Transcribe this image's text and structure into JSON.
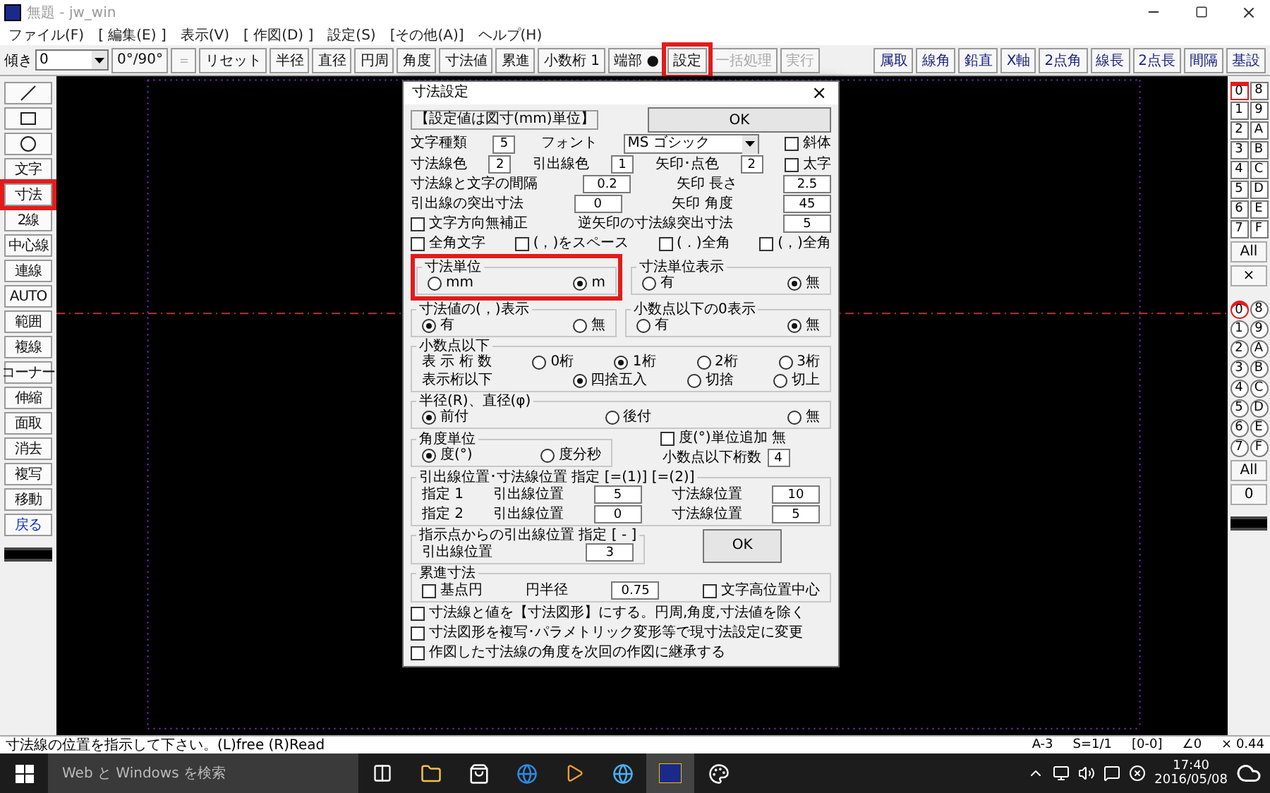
{
  "window": {
    "title": "無題 - jw_win"
  },
  "menu": [
    "ファイル(F)",
    "[ 編集(E) ]",
    "表示(V)",
    "[ 作図(D) ]",
    "設定(S)",
    "[その他(A)]",
    "ヘルプ(H)"
  ],
  "toolbar": {
    "tilt_label": "傾き",
    "tilt_value": "0",
    "buttons": [
      {
        "label": "0°/90°",
        "disabled": false,
        "highlighted": false
      },
      {
        "label": "＝",
        "disabled": true,
        "highlighted": false
      },
      {
        "label": "リセット",
        "disabled": false,
        "highlighted": false
      },
      {
        "label": "半径",
        "disabled": false,
        "highlighted": false
      },
      {
        "label": "直径",
        "disabled": false,
        "highlighted": false
      },
      {
        "label": "円周",
        "disabled": false,
        "highlighted": false
      },
      {
        "label": "角度",
        "disabled": false,
        "highlighted": false
      },
      {
        "label": "寸法値",
        "disabled": false,
        "highlighted": false
      },
      {
        "label": "累進",
        "disabled": false,
        "highlighted": false
      },
      {
        "label": "小数桁 1",
        "disabled": false,
        "highlighted": false
      },
      {
        "label": "端部 ●",
        "disabled": false,
        "highlighted": false
      },
      {
        "label": "設定",
        "disabled": false,
        "highlighted": true
      },
      {
        "label": "一括処理",
        "disabled": true,
        "highlighted": false
      },
      {
        "label": "実行",
        "disabled": true,
        "highlighted": false
      }
    ],
    "right_buttons": [
      "属取",
      "線角",
      "鉛直",
      "X軸",
      "2点角",
      "線長",
      "2点長",
      "間隔",
      "基設"
    ]
  },
  "left_tools": [
    {
      "kind": "line"
    },
    {
      "kind": "rectangle"
    },
    {
      "kind": "circle"
    },
    {
      "kind": "label",
      "label": "文字",
      "highlighted": false
    },
    {
      "kind": "label",
      "label": "寸法",
      "highlighted": true
    },
    {
      "kind": "label",
      "label": "2線",
      "highlighted": false
    },
    {
      "kind": "label",
      "label": "中心線",
      "highlighted": false
    },
    {
      "kind": "label",
      "label": "連線",
      "highlighted": false
    },
    {
      "kind": "label",
      "label": "AUTO",
      "highlighted": false
    },
    {
      "kind": "label",
      "label": "範囲",
      "highlighted": false
    },
    {
      "kind": "label",
      "label": "複線",
      "highlighted": false
    },
    {
      "kind": "label",
      "label": "コーナー",
      "highlighted": false
    },
    {
      "kind": "label",
      "label": "伸縮",
      "highlighted": false
    },
    {
      "kind": "label",
      "label": "面取",
      "highlighted": false
    },
    {
      "kind": "label",
      "label": "消去",
      "highlighted": false
    },
    {
      "kind": "label",
      "label": "複写",
      "highlighted": false
    },
    {
      "kind": "label",
      "label": "移動",
      "highlighted": false
    },
    {
      "kind": "label",
      "label": "戻る",
      "highlighted": false
    }
  ],
  "layers": {
    "items": [
      {
        "label": "0",
        "selected": true
      },
      {
        "label": "8",
        "selected": false
      },
      {
        "label": "1",
        "selected": false
      },
      {
        "label": "9",
        "selected": false
      },
      {
        "label": "2",
        "selected": false
      },
      {
        "label": "A",
        "selected": false
      },
      {
        "label": "3",
        "selected": false
      },
      {
        "label": "B",
        "selected": false
      },
      {
        "label": "4",
        "selected": false
      },
      {
        "label": "C",
        "selected": false
      },
      {
        "label": "5",
        "selected": false
      },
      {
        "label": "D",
        "selected": false
      },
      {
        "label": "6",
        "selected": false
      },
      {
        "label": "E",
        "selected": false
      },
      {
        "label": "7",
        "selected": false
      },
      {
        "label": "F",
        "selected": false
      }
    ],
    "all": "All",
    "cross": "×"
  },
  "layer_groups": {
    "items": [
      {
        "label": "0",
        "selected": true
      },
      {
        "label": "8",
        "selected": false
      },
      {
        "label": "1",
        "selected": false
      },
      {
        "label": "9",
        "selected": false
      },
      {
        "label": "2",
        "selected": false
      },
      {
        "label": "A",
        "selected": false
      },
      {
        "label": "3",
        "selected": false
      },
      {
        "label": "B",
        "selected": false
      },
      {
        "label": "4",
        "selected": false
      },
      {
        "label": "C",
        "selected": false
      },
      {
        "label": "5",
        "selected": false
      },
      {
        "label": "D",
        "selected": false
      },
      {
        "label": "6",
        "selected": false
      },
      {
        "label": "E",
        "selected": false
      },
      {
        "label": "7",
        "selected": false
      },
      {
        "label": "F",
        "selected": false
      }
    ],
    "all": "All",
    "extra": "0"
  },
  "dialog": {
    "title": "寸法設定",
    "close": "×",
    "note": "【設定値は図寸(mm)単位】",
    "ok": "OK",
    "sections": [
      {
        "kind": "row",
        "items": [
          {
            "kind": "label",
            "text": "文字種類"
          },
          {
            "kind": "field",
            "value": "5",
            "wide": false
          },
          {
            "kind": "label",
            "text": "フォント"
          },
          {
            "kind": "select",
            "value": "MS ゴシック"
          },
          {
            "kind": "checkbox",
            "label": "斜体",
            "checked": false
          }
        ]
      },
      {
        "kind": "row",
        "items": [
          {
            "kind": "label",
            "text": "寸法線色"
          },
          {
            "kind": "field",
            "value": "2",
            "wide": false
          },
          {
            "kind": "label",
            "text": "引出線色"
          },
          {
            "kind": "field",
            "value": "1",
            "wide": false
          },
          {
            "kind": "label",
            "text": "矢印･点色"
          },
          {
            "kind": "field",
            "value": "2",
            "wide": false
          },
          {
            "kind": "checkbox",
            "label": "太字",
            "checked": false
          }
        ]
      },
      {
        "kind": "row",
        "items": [
          {
            "kind": "label",
            "text": "寸法線と文字の間隔"
          },
          {
            "kind": "field",
            "value": "0.2",
            "wide": true
          },
          {
            "kind": "label",
            "text": "矢印 長さ"
          },
          {
            "kind": "field",
            "value": "2.5",
            "wide": true
          }
        ]
      },
      {
        "kind": "row",
        "items": [
          {
            "kind": "label",
            "text": "引出線の突出寸法"
          },
          {
            "kind": "field",
            "value": "0",
            "wide": true
          },
          {
            "kind": "label",
            "text": "矢印 角度"
          },
          {
            "kind": "field",
            "value": "45",
            "wide": true
          }
        ]
      },
      {
        "kind": "row",
        "items": [
          {
            "kind": "checkbox",
            "label": "文字方向無補正",
            "checked": false
          },
          {
            "kind": "label",
            "text": "逆矢印の寸法線突出寸法"
          },
          {
            "kind": "field",
            "value": "5",
            "wide": true
          }
        ]
      },
      {
        "kind": "row",
        "items": [
          {
            "kind": "checkbox",
            "label": "全角文字",
            "checked": false
          },
          {
            "kind": "checkbox",
            "label": "(，)をスペース",
            "checked": false
          },
          {
            "kind": "checkbox",
            "label": "(．)全角",
            "checked": false
          },
          {
            "kind": "checkbox",
            "label": "(，)全角",
            "checked": false
          }
        ]
      },
      {
        "kind": "groups",
        "groups": [
          {
            "title": "寸法単位",
            "highlighted": true,
            "rows": [
              [
                {
                  "kind": "radio",
                  "label": "mm",
                  "selected": false
                },
                {
                  "kind": "radio",
                  "label": "m",
                  "selected": true
                }
              ]
            ]
          },
          {
            "title": "寸法単位表示",
            "highlighted": false,
            "rows": [
              [
                {
                  "kind": "radio",
                  "label": "有",
                  "selected": false
                },
                {
                  "kind": "radio",
                  "label": "無",
                  "selected": true
                }
              ]
            ]
          }
        ]
      },
      {
        "kind": "groups",
        "groups": [
          {
            "title": "寸法値の(，)表示",
            "highlighted": false,
            "rows": [
              [
                {
                  "kind": "radio",
                  "label": "有",
                  "selected": true
                },
                {
                  "kind": "radio",
                  "label": "無",
                  "selected": false
                }
              ]
            ]
          },
          {
            "title": "小数点以下の0表示",
            "highlighted": false,
            "rows": [
              [
                {
                  "kind": "radio",
                  "label": "有",
                  "selected": false
                },
                {
                  "kind": "radio",
                  "label": "無",
                  "selected": true
                }
              ]
            ]
          }
        ]
      },
      {
        "kind": "groups",
        "groups": [
          {
            "title": "小数点以下",
            "highlighted": false,
            "rows": [
              [
                {
                  "kind": "label",
                  "text": "表 示 桁 数"
                },
                {
                  "kind": "radio",
                  "label": "0桁",
                  "selected": false
                },
                {
                  "kind": "radio",
                  "label": "1桁",
                  "selected": true
                },
                {
                  "kind": "radio",
                  "label": "2桁",
                  "selected": false
                },
                {
                  "kind": "radio",
                  "label": "3桁",
                  "selected": false
                }
              ],
              [
                {
                  "kind": "label",
                  "text": "表示桁以下"
                },
                "",
                {
                  "kind": "radio",
                  "label": "四捨五入",
                  "selected": true
                },
                {
                  "kind": "radio",
                  "label": "切捨",
                  "selected": false
                },
                {
                  "kind": "radio",
                  "label": "切上",
                  "selected": false
                }
              ]
            ]
          }
        ]
      },
      {
        "kind": "groups",
        "groups": [
          {
            "title": "半径(R)、直径(φ)",
            "highlighted": false,
            "rows": [
              [
                {
                  "kind": "radio",
                  "label": "前付",
                  "selected": true
                },
                {
                  "kind": "radio",
                  "label": "後付",
                  "selected": false
                },
                {
                  "kind": "radio",
                  "label": "無",
                  "selected": false
                }
              ]
            ]
          }
        ]
      },
      {
        "kind": "groups",
        "groups": [
          {
            "title": "角度単位",
            "highlighted": false,
            "rows": [
              [
                {
                  "kind": "radio",
                  "label": "度(°)",
                  "selected": true
                },
                {
                  "kind": "radio",
                  "label": "度分秒",
                  "selected": false
                }
              ]
            ]
          },
          {
            "rows": [
              [
                {
                  "kind": "checkbox",
                  "label": "度(°)単位追加 無",
                  "checked": false
                }
              ],
              [
                {
                  "kind": "label",
                  "text": "小数点以下桁数"
                },
                {
                  "kind": "field",
                  "value": "4",
                  "wide": false
                }
              ]
            ]
          }
        ]
      },
      {
        "kind": "groups",
        "groups": [
          {
            "title": "引出線位置･寸法線位置 指定 [=(1)] [=(2)]",
            "highlighted": false,
            "rows": [
              [
                {
                  "kind": "label",
                  "text": "指定 1"
                },
                {
                  "kind": "label",
                  "text": "引出線位置"
                },
                {
                  "kind": "field",
                  "value": "5",
                  "wide": true
                },
                {
                  "kind": "label",
                  "text": "寸法線位置"
                },
                {
                  "kind": "field",
                  "value": "10",
                  "wide": true
                }
              ],
              [
                {
                  "kind": "label",
                  "text": "指定 2"
                },
                {
                  "kind": "label",
                  "text": "引出線位置"
                },
                {
                  "kind": "field",
                  "value": "0",
                  "wide": true
                },
                {
                  "kind": "label",
                  "text": "寸法線位置"
                },
                {
                  "kind": "field",
                  "value": "5",
                  "wide": true
                }
              ]
            ]
          }
        ]
      },
      {
        "kind": "groups",
        "groups": [
          {
            "title": "指示点からの引出線位置 指定 [ - ]",
            "highlighted": false,
            "rows": [
              [
                {
                  "kind": "label",
                  "text": "引出線位置"
                },
                {
                  "kind": "field",
                  "value": "3",
                  "wide": true
                }
              ]
            ]
          },
          {
            "rows": [
              [
                {
                  "kind": "button",
                  "label": "OK"
                }
              ]
            ]
          }
        ]
      },
      {
        "kind": "groups",
        "groups": [
          {
            "title": "累進寸法",
            "highlighted": false,
            "rows": [
              [
                {
                  "kind": "checkbox",
                  "label": "基点円",
                  "checked": false
                },
                {
                  "kind": "label",
                  "text": "円半径"
                },
                {
                  "kind": "field",
                  "value": "0.75",
                  "wide": true
                },
                {
                  "kind": "checkbox",
                  "label": "文字高位置中心",
                  "checked": false
                }
              ]
            ]
          }
        ]
      },
      {
        "kind": "row",
        "items": [
          {
            "kind": "checkbox",
            "label": "寸法線と値を【寸法図形】にする。円周,角度,寸法値を除く",
            "checked": false
          }
        ]
      },
      {
        "kind": "row",
        "items": [
          {
            "kind": "checkbox",
            "label": "寸法図形を複写･パラメトリック変形等で現寸法設定に変更",
            "checked": false
          }
        ]
      },
      {
        "kind": "row",
        "items": [
          {
            "kind": "checkbox",
            "label": "作図した寸法線の角度を次回の作図に継承する",
            "checked": false
          }
        ]
      }
    ]
  },
  "status_bar": {
    "message": "寸法線の位置を指示して下さい。(L)free (R)Read",
    "cells": [
      "A-3",
      "S=1/1",
      "[0-0]",
      "∠0",
      "× 0.44"
    ]
  },
  "taskbar": {
    "search_placeholder": "Web と Windows を検索",
    "time": "17:40",
    "date": "2016/05/08"
  }
}
